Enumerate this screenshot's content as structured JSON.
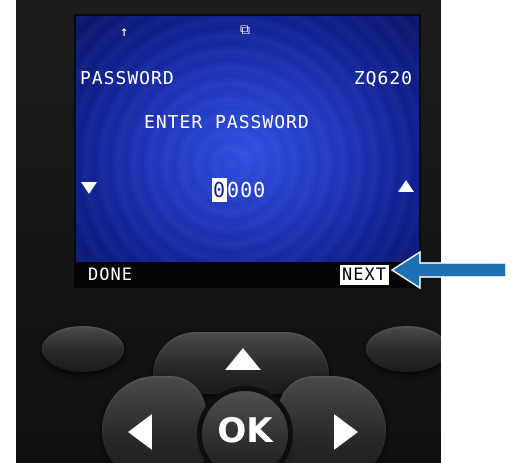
{
  "screen": {
    "status_icons": [
      "antenna-icon",
      "link-icon"
    ],
    "title_left": "PASSWORD",
    "title_right": "ZQ620",
    "prompt": "ENTER PASSWORD",
    "password_cursor_digit": "0",
    "password_rest": "000",
    "left_arrow_icon": "down-triangle-icon",
    "right_arrow_icon": "up-triangle-icon"
  },
  "softkeys": {
    "left_label": "DONE",
    "right_label": "NEXT"
  },
  "keypad": {
    "ok_label": "OK",
    "up_icon": "up-arrow-icon",
    "left_icon": "left-arrow-icon",
    "right_icon": "right-arrow-icon"
  },
  "callout": {
    "color": "#1f6fb5",
    "points_to": "NEXT"
  },
  "colors": {
    "screen_blue": "#1f37c0",
    "device_black": "#141414",
    "text_white": "#ffffff"
  }
}
